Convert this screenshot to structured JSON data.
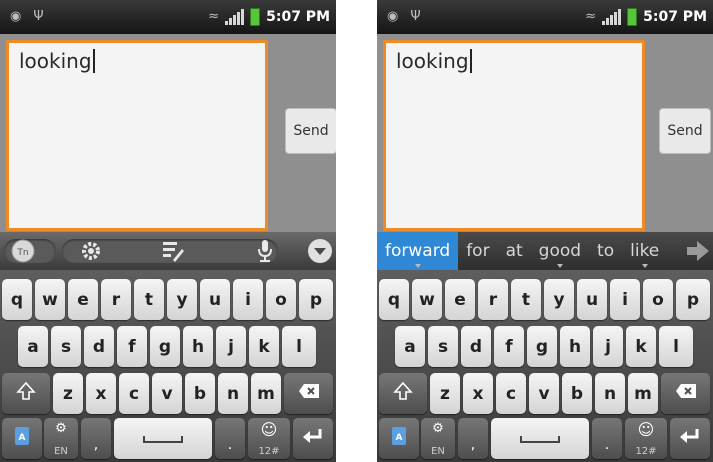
{
  "phones": [
    {
      "status": {
        "time": "5:07 PM"
      },
      "compose": {
        "text": "looking"
      },
      "send_label": "Send",
      "keyboard": {
        "row1": [
          "q",
          "w",
          "e",
          "r",
          "t",
          "y",
          "u",
          "i",
          "o",
          "p"
        ],
        "row2": [
          "a",
          "s",
          "d",
          "f",
          "g",
          "h",
          "j",
          "k",
          "l"
        ],
        "row3": [
          "z",
          "x",
          "c",
          "v",
          "b",
          "n",
          "m"
        ],
        "lang_label": "EN",
        "comma": ",",
        "period": ".",
        "sym_label": "12#"
      }
    },
    {
      "status": {
        "time": "5:07 PM"
      },
      "compose": {
        "text": "looking"
      },
      "send_label": "Send",
      "suggestions": [
        "forward",
        "for",
        "at",
        "good",
        "to",
        "like"
      ],
      "keyboard": {
        "row1": [
          "q",
          "w",
          "e",
          "r",
          "t",
          "y",
          "u",
          "i",
          "o",
          "p"
        ],
        "row2": [
          "a",
          "s",
          "d",
          "f",
          "g",
          "h",
          "j",
          "k",
          "l"
        ],
        "row3": [
          "z",
          "x",
          "c",
          "v",
          "b",
          "n",
          "m"
        ],
        "lang_label": "EN",
        "comma": ",",
        "period": ".",
        "sym_label": "12#"
      }
    }
  ],
  "icons": [
    "android-icon",
    "usb-icon",
    "wifi-icon",
    "signal-icon",
    "battery-icon",
    "settings-icon",
    "edit-icon",
    "microphone-icon",
    "hide-keyboard-icon",
    "shift-icon",
    "backspace-icon",
    "enter-icon",
    "emoji-icon",
    "input-method-icon",
    "next-arrow-icon"
  ]
}
